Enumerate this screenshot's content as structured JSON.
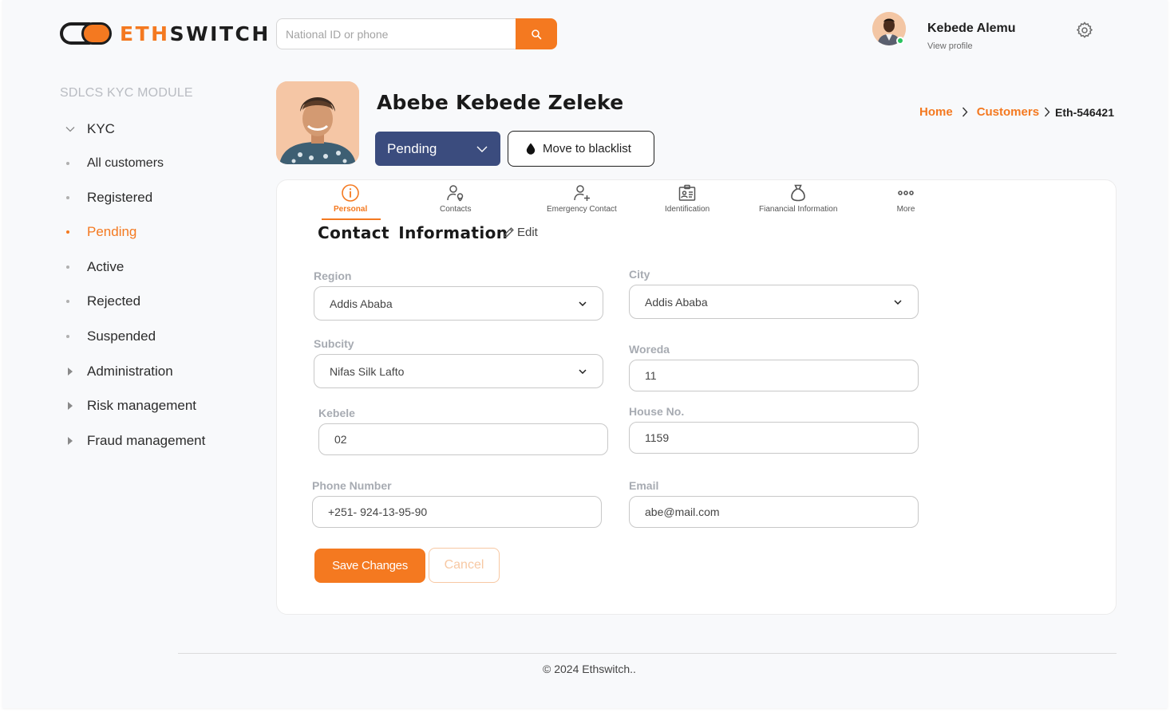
{
  "brand": {
    "name_part1": "ETH",
    "name_part2": "SWITCH",
    "accent": "#f47920",
    "dark": "#1d1d1d"
  },
  "search": {
    "placeholder": "National ID or phone",
    "button_icon": "search-icon"
  },
  "user": {
    "name": "Kebede Alemu",
    "profile_link": "View profile",
    "status": "online",
    "settings_icon": "gear-icon"
  },
  "sidebar": {
    "module_title": "SDLCS  KYC MODULE",
    "items": [
      {
        "label": "KYC",
        "icon": "chevron-down-icon",
        "kind": "group-open"
      },
      {
        "label": "All customers",
        "icon": "dot-icon",
        "kind": "sub"
      },
      {
        "label": "Registered",
        "icon": "dot-icon",
        "kind": "sub"
      },
      {
        "label": "Pending",
        "icon": "dot-icon",
        "kind": "sub",
        "active": true
      },
      {
        "label": "Active",
        "icon": "dot-icon",
        "kind": "sub"
      },
      {
        "label": "Rejected",
        "icon": "dot-icon",
        "kind": "sub"
      },
      {
        "label": "Suspended",
        "icon": "dot-icon",
        "kind": "sub"
      },
      {
        "label": "Administration",
        "icon": "caret-right-icon",
        "kind": "group"
      },
      {
        "label": "Risk management",
        "icon": "caret-right-icon",
        "kind": "group"
      },
      {
        "label": "Fraud management",
        "icon": "caret-right-icon",
        "kind": "group"
      }
    ]
  },
  "customer": {
    "name": "Abebe Kebede Zeleke",
    "status": "Pending",
    "status_color": "#3b4c7e",
    "blacklist_label": "Move to blacklist"
  },
  "breadcrumb": {
    "home": "Home",
    "customers": "Customers",
    "current": "Eth-546421"
  },
  "tabs": [
    {
      "label": "Personal",
      "icon": "info-icon",
      "active": true
    },
    {
      "label": "Contacts",
      "icon": "user-pin-icon"
    },
    {
      "label": "Emergency Contact",
      "icon": "user-add-icon"
    },
    {
      "label": "Identification",
      "icon": "id-card-icon"
    },
    {
      "label": "Fianancial Information",
      "icon": "money-bag-icon"
    },
    {
      "label": "More",
      "icon": "more-dots-icon"
    }
  ],
  "form": {
    "title": "Contact  Information",
    "edit_label": "Edit",
    "region": {
      "label": "Region",
      "value": "Addis Ababa"
    },
    "city": {
      "label": "City",
      "value": "Addis Ababa"
    },
    "subcity": {
      "label": "Subcity",
      "value": "Nifas Silk Lafto"
    },
    "woreda": {
      "label": "Woreda",
      "value": "11"
    },
    "kebele": {
      "label": "Kebele",
      "value": "02"
    },
    "house": {
      "label": "House No.",
      "value": "1159"
    },
    "phone": {
      "label": "Phone Number",
      "value": "+251- 924-13-95-90"
    },
    "email": {
      "label": "Email",
      "value": "abe@mail.com"
    },
    "save_label": "Save Changes",
    "cancel_label": "Cancel"
  },
  "footer": {
    "text": "© 2024  Ethswitch.."
  }
}
